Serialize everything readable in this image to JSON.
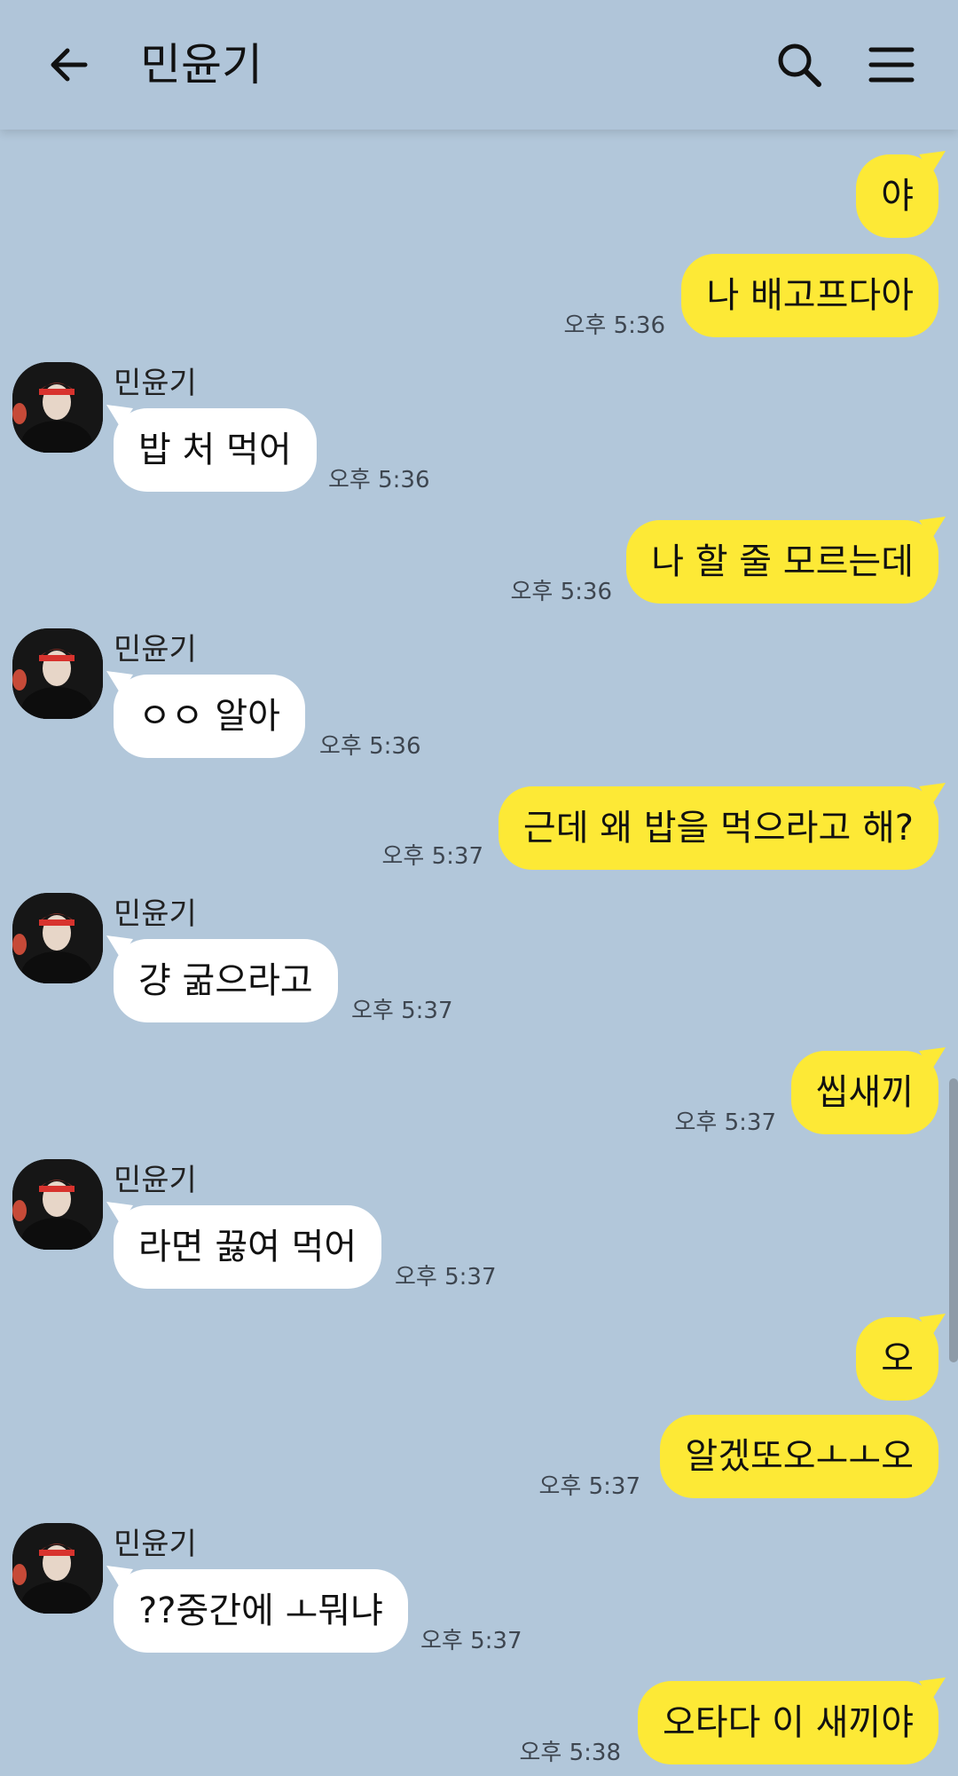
{
  "header": {
    "title": "민윤기",
    "back_icon": "back-arrow-icon",
    "search_icon": "search-icon",
    "menu_icon": "menu-icon"
  },
  "colors": {
    "background": "#b2c7da",
    "my_bubble": "#fde936",
    "their_bubble": "#ffffff"
  },
  "messages": [
    {
      "from": "me",
      "text": "야",
      "time": ""
    },
    {
      "from": "me",
      "text": "나 배고프다아",
      "time": "오후 5:36"
    },
    {
      "from": "them",
      "sender": "민윤기",
      "text": "밥 처 먹어",
      "time": "오후 5:36"
    },
    {
      "from": "me",
      "text": "나 할 줄 모르는데",
      "time": "오후 5:36"
    },
    {
      "from": "them",
      "sender": "민윤기",
      "text": "ㅇㅇ 알아",
      "time": "오후 5:36"
    },
    {
      "from": "me",
      "text": "근데 왜 밥을 먹으라고 해?",
      "time": "오후 5:37"
    },
    {
      "from": "them",
      "sender": "민윤기",
      "text": "걍 굶으라고",
      "time": "오후 5:37"
    },
    {
      "from": "me",
      "text": "씹새끼",
      "time": "오후 5:37"
    },
    {
      "from": "them",
      "sender": "민윤기",
      "text": "라면 끓여 먹어",
      "time": "오후 5:37"
    },
    {
      "from": "me",
      "text": "오",
      "time": ""
    },
    {
      "from": "me",
      "text": "알겠또오ㅗㅗ오",
      "time": "오후 5:37"
    },
    {
      "from": "them",
      "sender": "민윤기",
      "text": "??중간에 ㅗ뭐냐",
      "time": "오후 5:37"
    },
    {
      "from": "me",
      "text": "오타다 이 새끼야",
      "time": "오후 5:38"
    }
  ]
}
